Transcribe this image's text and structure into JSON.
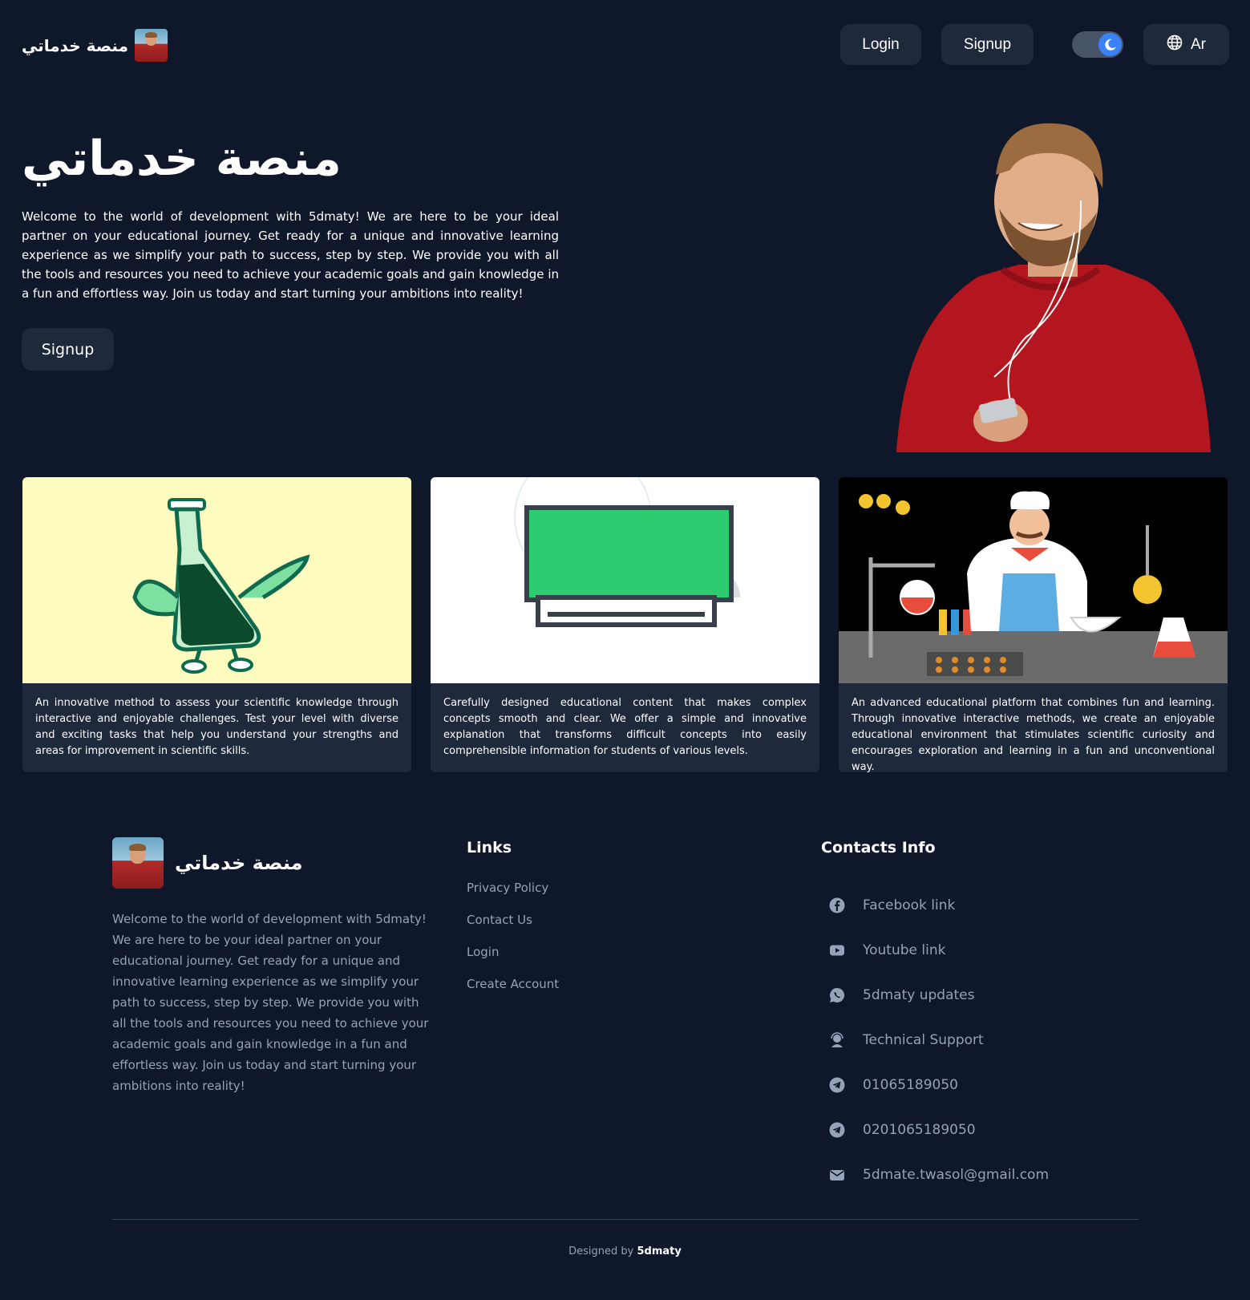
{
  "header": {
    "brand_name": "منصة خدماتي",
    "login_label": "Login",
    "signup_label": "Signup",
    "language_label": "Ar",
    "theme": "dark"
  },
  "hero": {
    "title": "منصة خدماتي",
    "description": "Welcome to the world of development with 5dmaty! We are here to be your ideal partner on your educational journey. Get ready for a unique and innovative learning experience as we simplify your path to success, step by step. We provide you with all the tools and resources you need to achieve your academic goals and gain knowledge in a fun and effortless way. Join us today and start turning your ambitions into reality!",
    "signup_label": "Signup"
  },
  "cards": [
    {
      "image": "flask-character-illustration",
      "text": "An innovative method to assess your scientific knowledge through interactive and enjoyable challenges. Test your level with diverse and exciting tasks that help you understand your strengths and areas for improvement in scientific skills."
    },
    {
      "image": "green-board-illustration",
      "text": "Carefully designed educational content that makes complex concepts smooth and clear. We offer a simple and innovative explanation that transforms difficult concepts into easily comprehensible information for students of various levels."
    },
    {
      "image": "chef-laboratory-illustration",
      "text": "An advanced educational platform that combines fun and learning. Through innovative interactive methods, we create an enjoyable educational environment that stimulates scientific curiosity and encourages exploration and learning in a fun and unconventional way."
    }
  ],
  "footer": {
    "brand_name": "منصة خدماتي",
    "about": "Welcome to the world of development with 5dmaty! We are here to be your ideal partner on your educational journey. Get ready for a unique and innovative learning experience as we simplify your path to success, step by step. We provide you with all the tools and resources you need to achieve your academic goals and gain knowledge in a fun and effortless way. Join us today and start turning your ambitions into reality!",
    "links_heading": "Links",
    "links": [
      "Privacy Policy",
      "Contact Us",
      "Login",
      "Create Account"
    ],
    "contacts_heading": "Contacts Info",
    "contacts": [
      {
        "icon": "facebook-icon",
        "label": "Facebook link"
      },
      {
        "icon": "youtube-icon",
        "label": "Youtube link"
      },
      {
        "icon": "whatsapp-icon",
        "label": "5dmaty updates"
      },
      {
        "icon": "support-icon",
        "label": "Technical Support"
      },
      {
        "icon": "telegram-icon",
        "label": "01065189050"
      },
      {
        "icon": "telegram-icon",
        "label": "0201065189050"
      },
      {
        "icon": "mail-icon",
        "label": "5dmate.twasol@gmail.com"
      }
    ],
    "credit_prefix": "Designed by",
    "credit_name": "5dmaty"
  },
  "colors": {
    "background": "#0f172a",
    "surface": "#1e293b",
    "accent": "#3b82f6",
    "muted_text": "#94a3b8"
  }
}
